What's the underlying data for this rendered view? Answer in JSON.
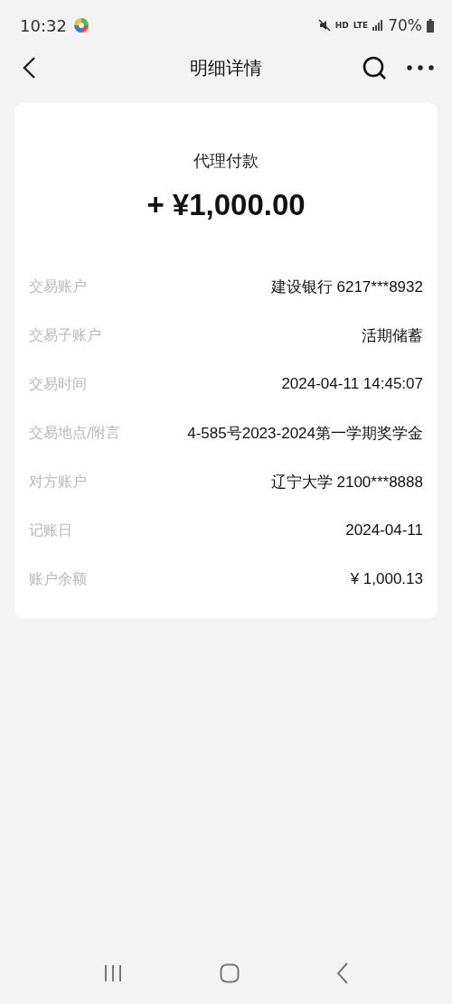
{
  "status_bar": {
    "time": "10:32",
    "hd": "HD",
    "network": "LTE",
    "battery": "70%"
  },
  "header": {
    "title": "明细详情"
  },
  "card": {
    "type": "代理付款",
    "amount": "+ ¥1,000.00",
    "rows": [
      {
        "label": "交易账户",
        "value": "建设银行 6217***8932"
      },
      {
        "label": "交易子账户",
        "value": "活期储蓄"
      },
      {
        "label": "交易时间",
        "value": "2024-04-11 14:45:07"
      },
      {
        "label": "交易地点/附言",
        "value": "4-585号2023-2024第一学期奖学金"
      },
      {
        "label": "对方账户",
        "value": "辽宁大学 2100***8888"
      },
      {
        "label": "记账日",
        "value": "2024-04-11"
      },
      {
        "label": "账户余额",
        "value": "¥ 1,000.13"
      }
    ]
  }
}
